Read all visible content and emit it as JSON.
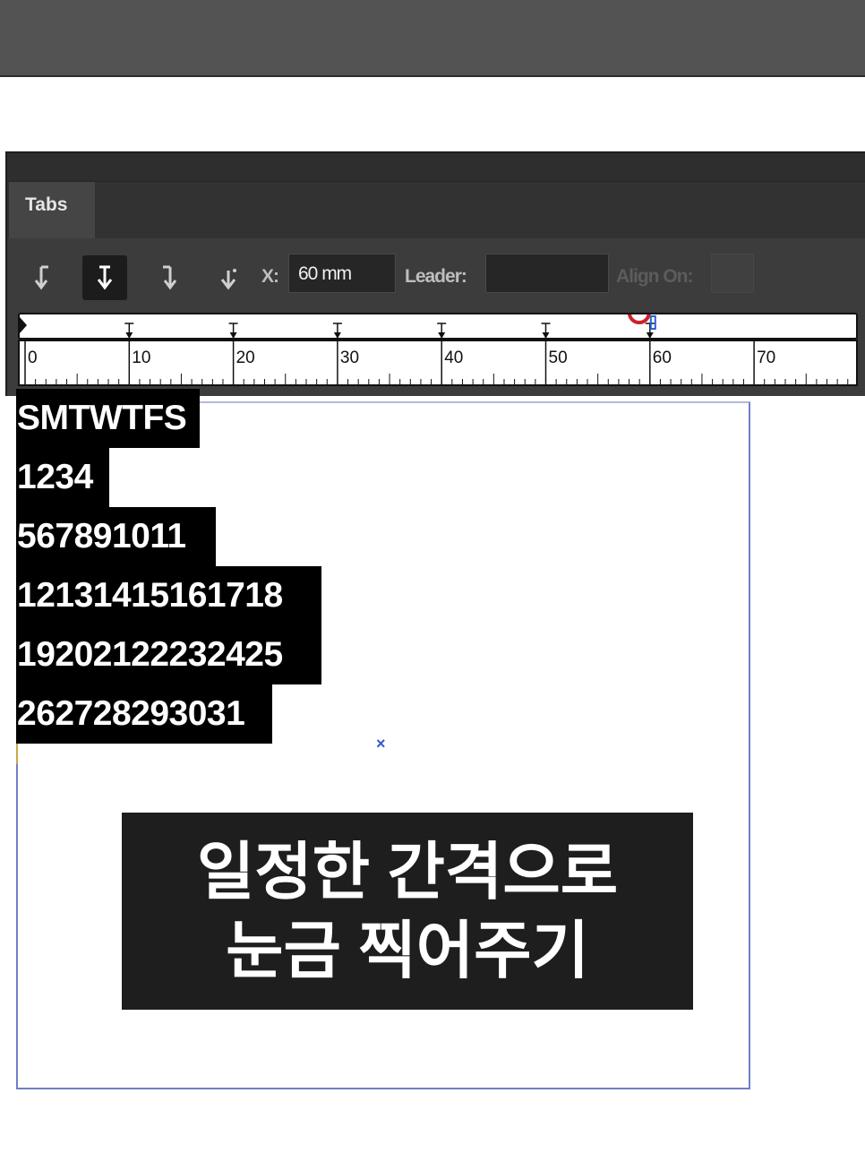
{
  "panel": {
    "tab_label": "Tabs",
    "x_label": "X:",
    "x_value": "60 mm",
    "leader_label": "Leader:",
    "leader_value": "",
    "align_on_label": "Align On:",
    "align_on_value": "",
    "tool_icons": [
      "left-justified-tab-icon",
      "center-justified-tab-icon",
      "right-justified-tab-icon",
      "align-to-decimal-tab-icon"
    ],
    "active_tool": "center-justified-tab-icon"
  },
  "ruler": {
    "unit": "mm",
    "labels": [
      "0",
      "10",
      "20",
      "30",
      "40",
      "50",
      "60",
      "70"
    ],
    "tab_stops_mm": [
      10,
      20,
      30,
      40,
      50,
      60
    ],
    "selected_tab_mm": 60
  },
  "text_frame": {
    "lines": [
      "SMTWTFS",
      "1234",
      "567891011",
      "12131415161718",
      "19202122232425",
      "262728293031"
    ]
  },
  "caption": {
    "line1": "일정한 간격으로",
    "line2": "눈금 찍어주기"
  },
  "colors": {
    "panel_bg": "#3c3c3c",
    "selection_bg": "#000000",
    "frame_border": "#6f7fc4",
    "cursor_ring": "#d0202a",
    "caption_bg": "#1e1e1e"
  }
}
